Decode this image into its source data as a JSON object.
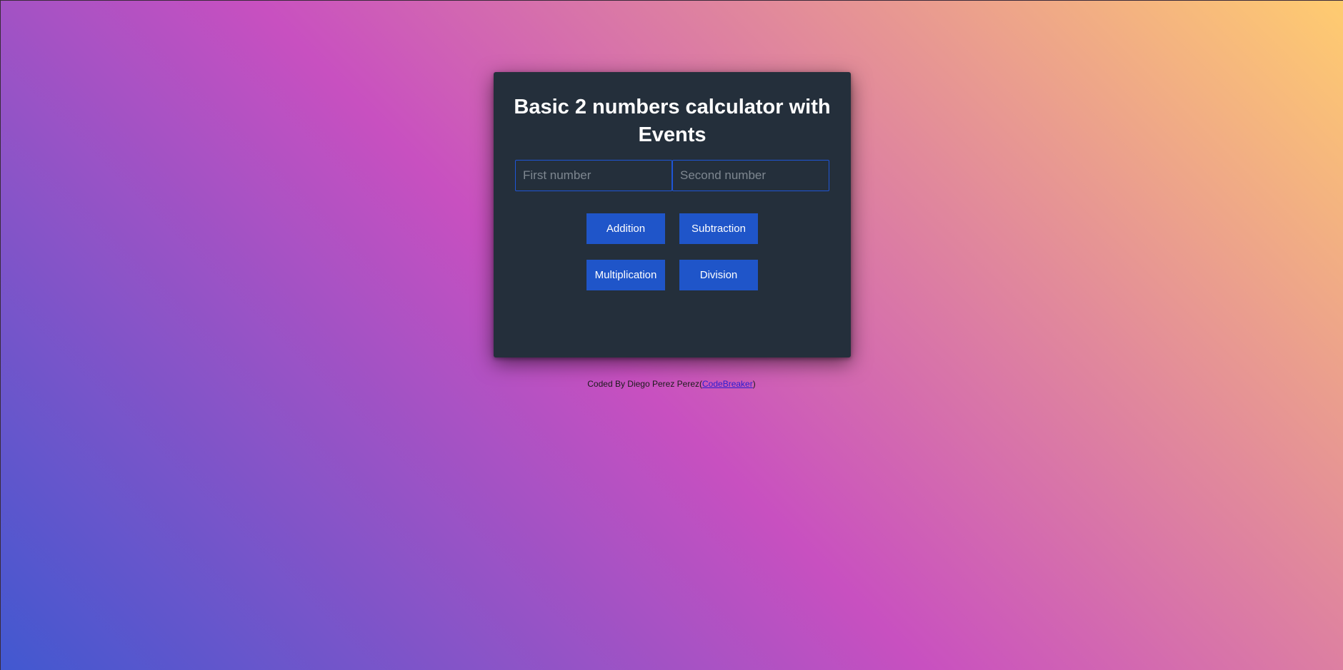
{
  "calculator": {
    "title": "Basic 2 numbers calculator with Events",
    "first_placeholder": "First number",
    "second_placeholder": "Second number",
    "buttons": {
      "addition": "Addition",
      "subtraction": "Subtraction",
      "multiplication": "Multiplication",
      "division": "Division"
    }
  },
  "footer": {
    "prefix": "Coded By Diego Perez Perez",
    "open_paren": "(",
    "link_text": "CodeBreaker",
    "close_paren": ")"
  },
  "colors": {
    "card_background": "#242f3b",
    "button_background": "#1f55c9",
    "input_border": "#1f55d6",
    "gradient_start": "#4158D0",
    "gradient_mid": "#C850C0",
    "gradient_end": "#FFCC70"
  }
}
